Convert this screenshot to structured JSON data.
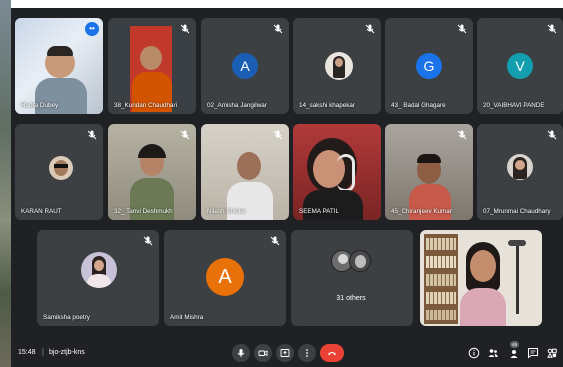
{
  "meeting": {
    "time": "15:48",
    "separator": "|",
    "code": "bjo-ztjb-kns"
  },
  "participants": {
    "p1": {
      "name": "Rudra Dubey",
      "muted": false,
      "speaking": true
    },
    "p2": {
      "name": "38_Kundan Chaudhari",
      "muted": true
    },
    "p3": {
      "name": "02_Amisha Jangilwar",
      "initial": "A",
      "color": "#1a5fb4",
      "muted": true
    },
    "p4": {
      "name": "14_sakshi khapekar",
      "muted": true
    },
    "p5": {
      "name": "43_ Badal Ghagare",
      "initial": "G",
      "color": "#1a73e8",
      "muted": true
    },
    "p6": {
      "name": "20_VAIBHAVI PANDE",
      "initial": "V",
      "color": "#129eaf",
      "muted": true
    },
    "p7": {
      "name": "KARAN RAUT",
      "muted": true
    },
    "p8": {
      "name": "32_ Tanvi Deshmukh",
      "muted": true
    },
    "p9": {
      "name": "Nilesh Shelke",
      "muted": true
    },
    "p10": {
      "name": "SEEMA PATIL",
      "muted": false
    },
    "p11": {
      "name": "45_Chiranjeev Kumar",
      "muted": true
    },
    "p12": {
      "name": "07_Mrunmai Chaudhary",
      "muted": true
    },
    "p13": {
      "name": "Samiksha poetry",
      "muted": true
    },
    "p14": {
      "name": "Amit Mishra",
      "initial": "A",
      "color": "#e8710a",
      "muted": true
    },
    "others": {
      "label": "31 others"
    },
    "p15": {
      "name": "",
      "muted": false
    }
  },
  "controls": {
    "mic": "mic-icon",
    "camera": "camera-icon",
    "present": "present-icon",
    "more": "more-options-icon",
    "end": "end-call-icon"
  },
  "right_controls": {
    "info": "info-icon",
    "people_count": "46",
    "people": "people-icon",
    "chat": "chat-icon",
    "activities": "activities-icon"
  },
  "colors": {
    "background": "#202124",
    "tile": "#3c4043",
    "end_call": "#ea4335",
    "active_border": "#8ab4f8"
  }
}
